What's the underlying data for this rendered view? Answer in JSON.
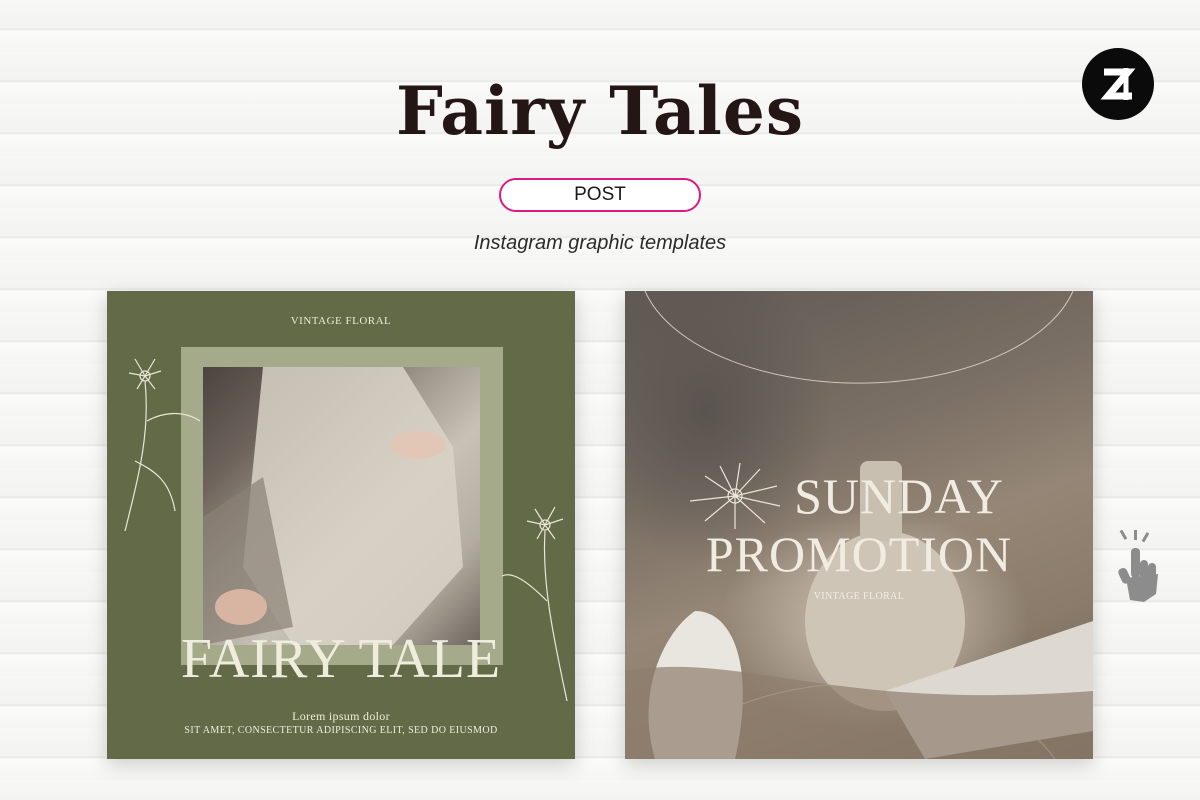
{
  "header": {
    "title": "Fairy Tales",
    "badge": "POST",
    "subtitle": "Instagram graphic templates"
  },
  "colors": {
    "title": "#231615",
    "badge_border": "#e0197c",
    "left_card_bg": "#636a47",
    "left_frame": "#a5ab8a",
    "card_text": "#efedde"
  },
  "left_card": {
    "top_label": "VINTAGE FLORAL",
    "headline": "FAIRY TALE",
    "line1": "Lorem ipsum dolor",
    "line2": "SIT AMET, CONSECTETUR ADIPISCING ELIT, SED DO EIUSMOD"
  },
  "right_card": {
    "headline_line1": "SUNDAY",
    "headline_line2": "PROMOTION",
    "label": "VINTAGE FLORAL"
  },
  "icons": {
    "logo": "brand-logo-icon",
    "hand": "pointer-hand-icon",
    "flower": "daisy-flower-icon"
  }
}
